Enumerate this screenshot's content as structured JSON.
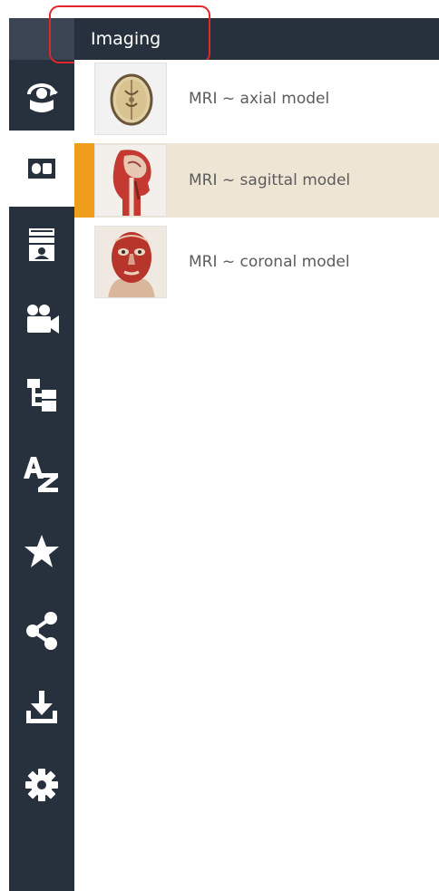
{
  "header": {
    "title": "Imaging"
  },
  "sidebar": {
    "items": [
      {
        "icon": "rotate-model-icon",
        "active": false
      },
      {
        "icon": "imaging-icon",
        "active": true
      },
      {
        "icon": "quiz-icon",
        "active": false
      },
      {
        "icon": "video-camera-icon",
        "active": false
      },
      {
        "icon": "hierarchy-tree-icon",
        "active": false
      },
      {
        "icon": "a-z-index-icon",
        "active": false
      },
      {
        "icon": "star-favorites-icon",
        "active": false
      },
      {
        "icon": "share-icon",
        "active": false
      },
      {
        "icon": "download-icon",
        "active": false
      },
      {
        "icon": "settings-gear-icon",
        "active": false
      }
    ]
  },
  "list": {
    "items": [
      {
        "label": "MRI ~ axial model",
        "thumbnail": "brain-axial-slice-thumbnail",
        "selected": false
      },
      {
        "label": "MRI ~ sagittal model",
        "thumbnail": "head-sagittal-section-thumbnail",
        "selected": true
      },
      {
        "label": "MRI ~ coronal model",
        "thumbnail": "head-coronal-face-muscles-thumbnail",
        "selected": false
      }
    ]
  },
  "colors": {
    "sidebar_bg": "#27313d",
    "header_bg": "#27313d",
    "sidebar_icon": "#ffffff",
    "active_icon": "#27313d",
    "selected_row_bg": "#efe5d5",
    "selected_accent": "#ef9e1c",
    "annotation_border": "#e3262b",
    "label_text": "#5c5c5c"
  }
}
